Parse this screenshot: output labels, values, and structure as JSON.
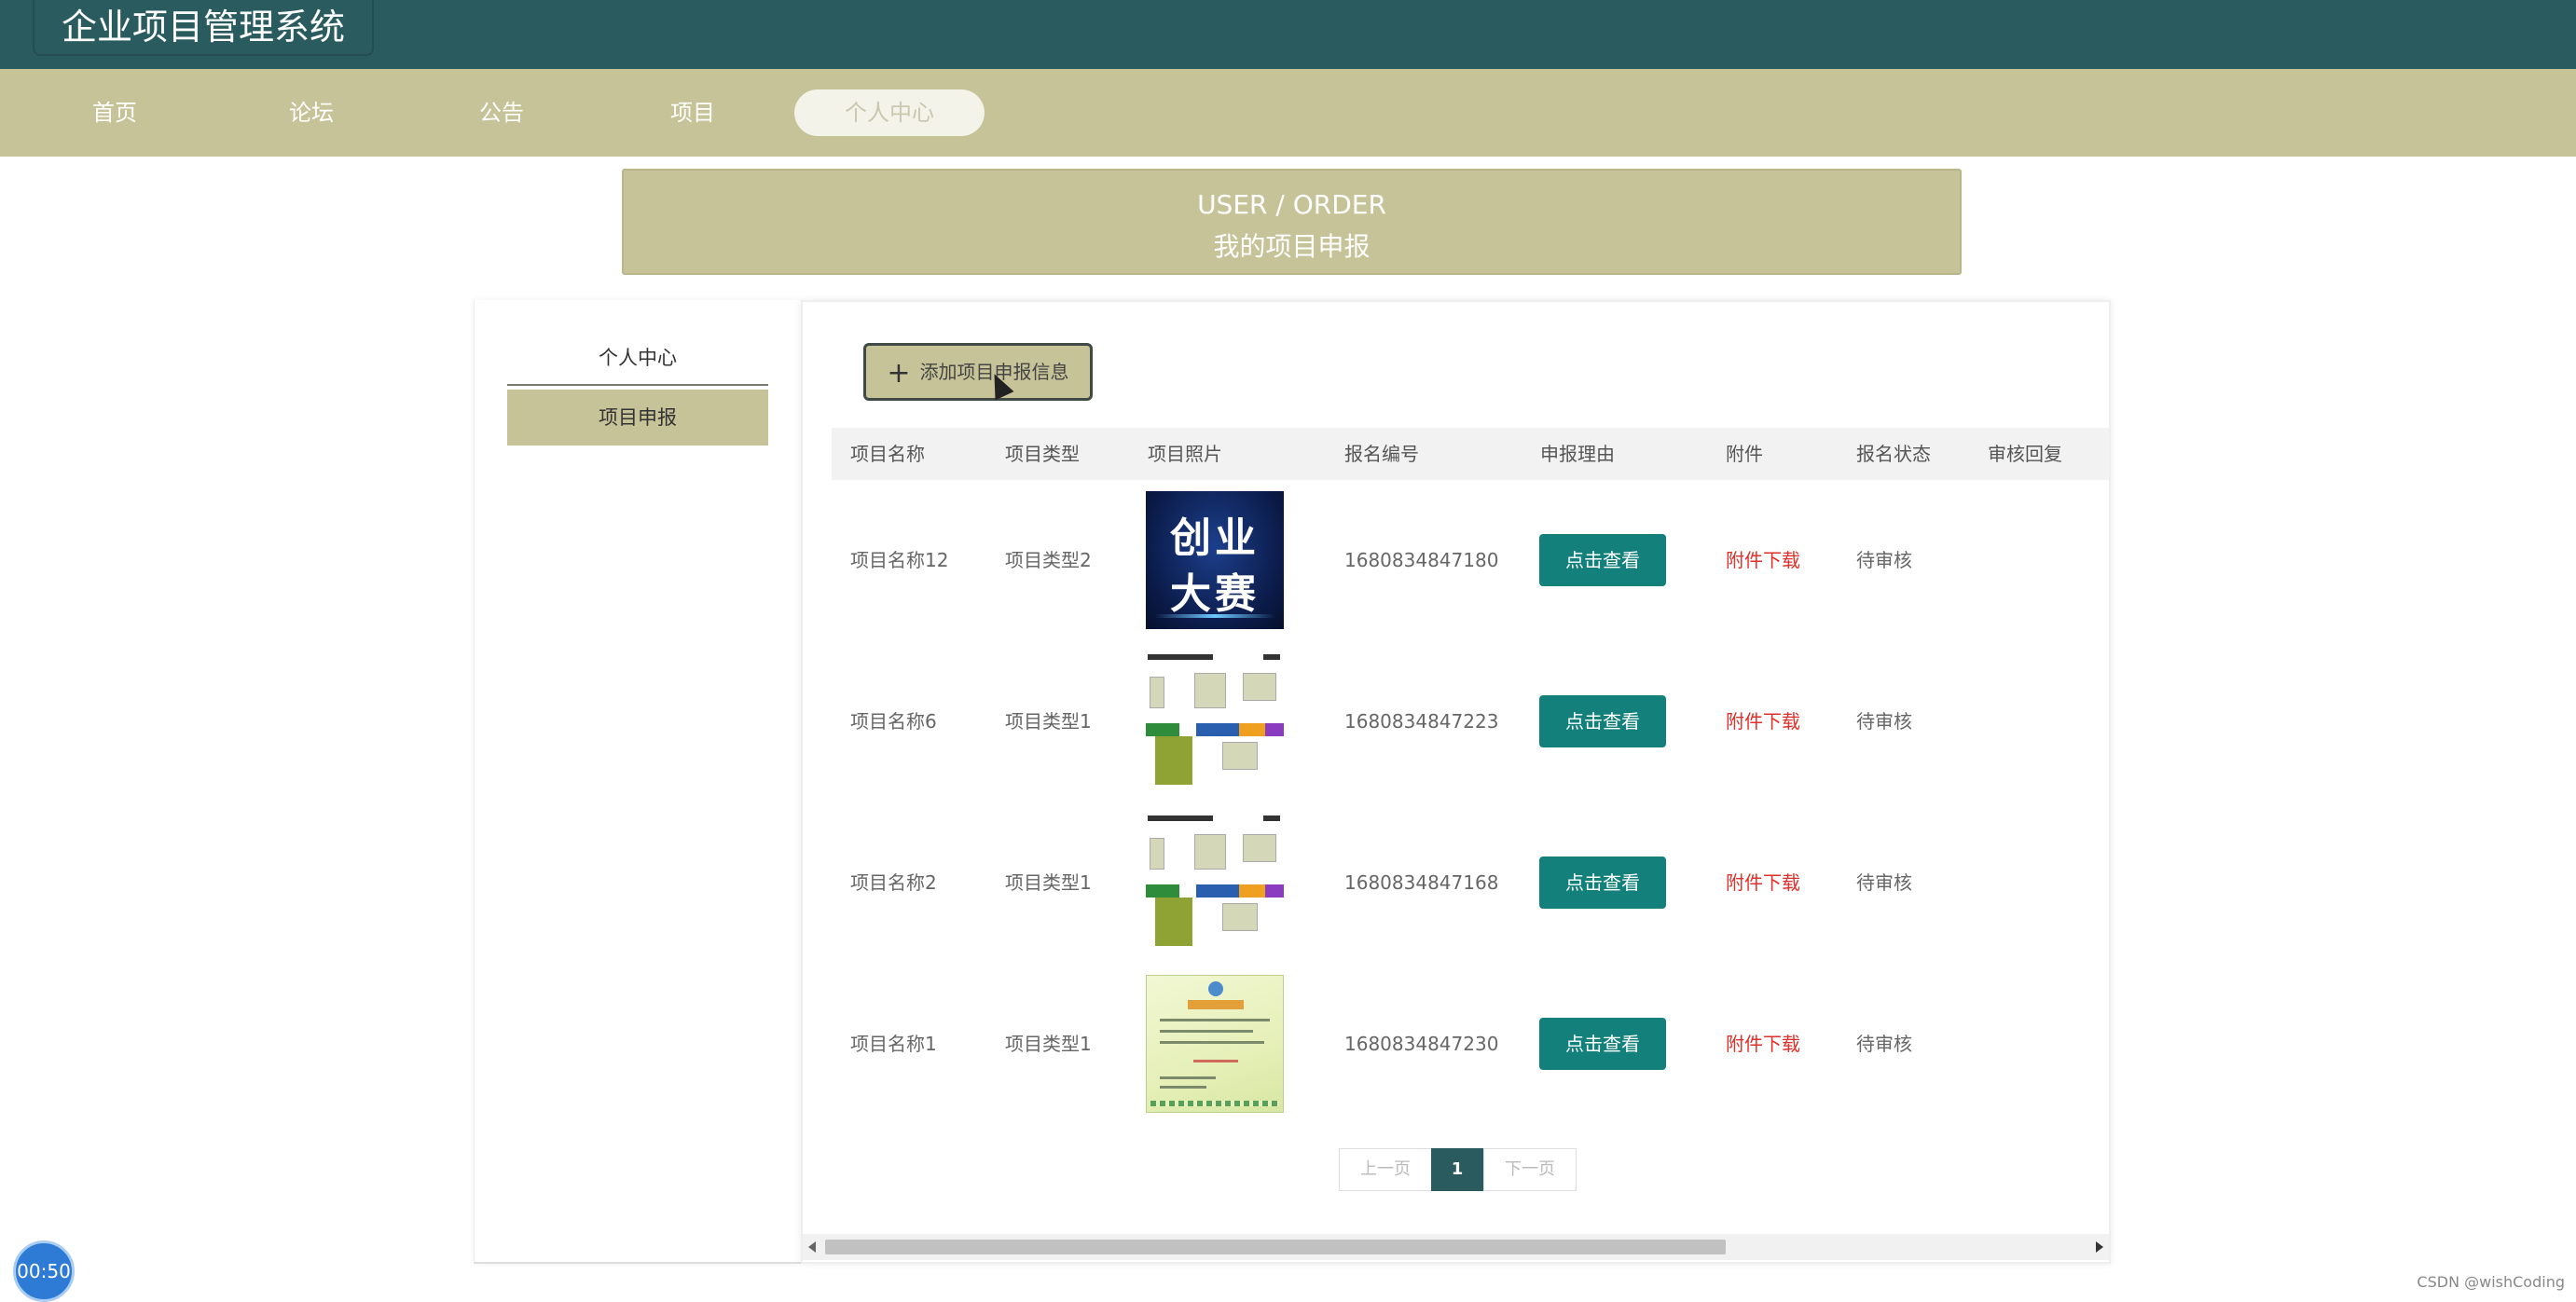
{
  "app": {
    "title": "企业项目管理系统"
  },
  "nav": {
    "items": [
      {
        "label": "首页"
      },
      {
        "label": "论坛"
      },
      {
        "label": "公告"
      },
      {
        "label": "项目"
      },
      {
        "label": "个人中心",
        "active": true
      }
    ]
  },
  "banner": {
    "en": "USER / ORDER",
    "cn": "我的项目申报"
  },
  "sidebar": {
    "items": [
      {
        "label": "个人中心"
      },
      {
        "label": "项目申报",
        "active": true
      }
    ]
  },
  "toolbar": {
    "add_icon": "plus-icon",
    "add_label": "添加项目申报信息"
  },
  "table": {
    "headers": [
      "项目名称",
      "项目类型",
      "项目照片",
      "报名编号",
      "申报理由",
      "附件",
      "报名状态",
      "审核回复"
    ],
    "rows": [
      {
        "name": "项目名称12",
        "type": "项目类型2",
        "photo": "创业大赛",
        "code": "1680834847180",
        "reason_btn": "点击查看",
        "attachment": "附件下载",
        "status": "待审核",
        "reply": ""
      },
      {
        "name": "项目名称6",
        "type": "项目类型1",
        "photo": "flowchart",
        "code": "1680834847223",
        "reason_btn": "点击查看",
        "attachment": "附件下载",
        "status": "待审核",
        "reply": ""
      },
      {
        "name": "项目名称2",
        "type": "项目类型1",
        "photo": "flowchart",
        "code": "1680834847168",
        "reason_btn": "点击查看",
        "attachment": "附件下载",
        "status": "待审核",
        "reply": ""
      },
      {
        "name": "项目名称1",
        "type": "项目类型1",
        "photo": "certificate",
        "code": "1680834847230",
        "reason_btn": "点击查看",
        "attachment": "附件下载",
        "status": "待审核",
        "reply": ""
      }
    ],
    "thumb_a_line1": "创业",
    "thumb_a_line2": "大赛"
  },
  "pagination": {
    "prev": "上一页",
    "current": "1",
    "next": "下一页"
  },
  "timer": {
    "value": "00:50"
  },
  "watermark": "CSDN @wishCoding",
  "colors": {
    "header": "#2a5c5f",
    "accent": "#c5c397",
    "button": "#13807c",
    "link_red": "#e0302a"
  }
}
